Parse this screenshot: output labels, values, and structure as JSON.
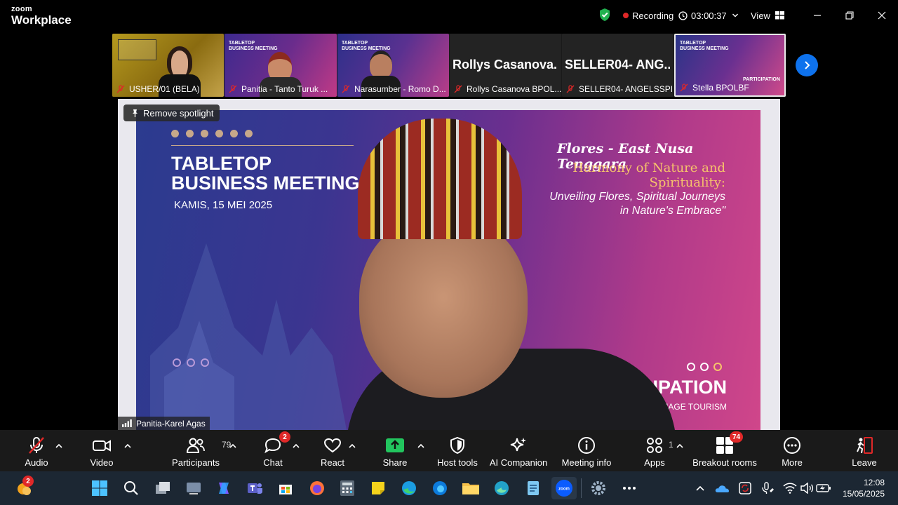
{
  "app": {
    "brand_small": "zoom",
    "brand_big": "Workplace"
  },
  "titlebar": {
    "recording": "Recording",
    "timer": "03:00:37",
    "view": "View"
  },
  "thumbnails": [
    {
      "name": "USHER/01 (BELA)",
      "type": "video"
    },
    {
      "name": "Panitia - Tanto Turuk ...",
      "type": "video"
    },
    {
      "name": "Narasumber - Romo D...",
      "type": "video"
    },
    {
      "name": "Rollys Casanova BPOL...",
      "big": "Rollys Casanova...",
      "type": "name"
    },
    {
      "name": "SELLER04- ANGELSSPI...",
      "big": "SELLER04- ANG...",
      "type": "name"
    },
    {
      "name": "Stella BPOLBF",
      "type": "video"
    }
  ],
  "main": {
    "spotlight_button": "Remove spotlight",
    "speaker": "Panitia-Karel Agas",
    "slide": {
      "title1": "TABLETOP",
      "title2": "BUSINESS MEETING",
      "date": "KAMIS, 15 MEI 2025",
      "region": "Flores - East Nusa Tenggara",
      "theme1": "Harmony of Nature and",
      "theme2": "Spirituality:",
      "quote1": "Unveiling Flores, Spiritual Journeys",
      "quote2": "in Nature's Embrace\"",
      "footer1": "CIPATION",
      "footer2": "GRIMAGE TOURISM"
    }
  },
  "toolbar": {
    "audio": "Audio",
    "video": "Video",
    "participants": "Participants",
    "participants_count": "79",
    "chat": "Chat",
    "chat_badge": "2",
    "react": "React",
    "share": "Share",
    "host_tools": "Host tools",
    "ai": "AI Companion",
    "info": "Meeting info",
    "apps": "Apps",
    "apps_count": "1",
    "breakout": "Breakout rooms",
    "breakout_badge": "74",
    "more": "More",
    "leave": "Leave"
  },
  "taskbar": {
    "weather_badge": "2",
    "time": "12:08",
    "date": "15/05/2025"
  },
  "colors": {
    "accent": "#0e72ed",
    "share": "#22c55e",
    "danger": "#e02828"
  }
}
